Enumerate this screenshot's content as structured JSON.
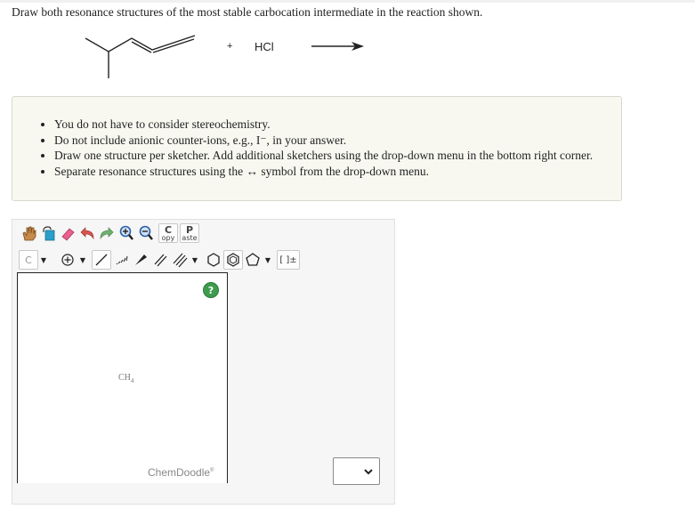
{
  "question": {
    "text": "Draw both resonance structures of the most stable carbocation intermediate in the reaction shown."
  },
  "reaction": {
    "plus": "+",
    "reagent": "HCl"
  },
  "instructions": [
    "You do not have to consider stereochemistry.",
    "Do not include anionic counter-ions, e.g., I⁻, in your answer.",
    "Draw one structure per sketcher. Add additional sketchers using the drop-down menu in the bottom right corner.",
    "Separate resonance structures using the ↔ symbol from the drop-down menu."
  ],
  "sketcher": {
    "toolbar_row1": [
      {
        "name": "hand-icon",
        "label": ""
      },
      {
        "name": "lasso-icon",
        "label": ""
      },
      {
        "name": "eraser-icon",
        "label": ""
      },
      {
        "name": "undo-icon",
        "label": ""
      },
      {
        "name": "redo-icon",
        "label": ""
      },
      {
        "name": "zoom-in-icon",
        "label": ""
      },
      {
        "name": "zoom-out-icon",
        "label": ""
      }
    ],
    "copy_button": {
      "letter": "C",
      "rest": "opy"
    },
    "paste_button": {
      "letter": "P",
      "rest": "aste"
    },
    "element_button": "C",
    "bracket_button": "[ ]±",
    "help_button": "?",
    "canvas_label": "CH",
    "canvas_label_sub": "4",
    "watermark": "ChemDoodle",
    "watermark_mark": "®"
  },
  "colors": {
    "instructions_bg": "#f8f8f1",
    "help_green": "#3e9b4d",
    "eraser_pink": "#e8608c",
    "undo_red": "#d9534f",
    "redo_green": "#6fb06f",
    "zoom_blue": "#2a5fa8"
  }
}
